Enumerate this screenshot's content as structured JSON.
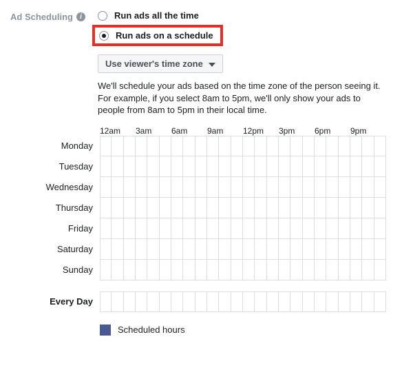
{
  "section_label": "Ad Scheduling",
  "radio_options": {
    "all_time": "Run ads all the time",
    "on_schedule": "Run ads on a schedule"
  },
  "dropdown": {
    "selected": "Use viewer's time zone"
  },
  "help_text": {
    "line1": "We'll schedule your ads based on the time zone of the person seeing it.",
    "line2": "For example, if you select 8am to 5pm, we'll only show your ads to people from 8am to 5pm in their local time."
  },
  "time_headers": [
    "12am",
    "3am",
    "6am",
    "9am",
    "12pm",
    "3pm",
    "6pm",
    "9pm"
  ],
  "days": [
    "Monday",
    "Tuesday",
    "Wednesday",
    "Thursday",
    "Friday",
    "Saturday",
    "Sunday"
  ],
  "every_day_label": "Every Day",
  "legend_label": "Scheduled hours",
  "colors": {
    "highlight": "#e22f27",
    "legend_swatch": "#475993"
  }
}
